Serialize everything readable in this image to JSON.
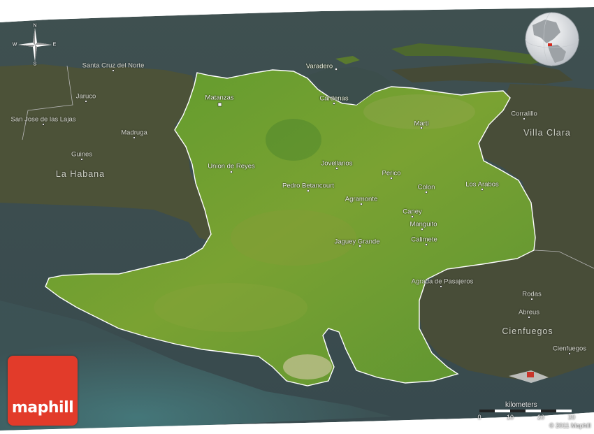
{
  "map": {
    "province": "Matanzas",
    "provincial_cities": [
      {
        "name": "Matanzas",
        "capital": true
      },
      {
        "name": "Cardenas"
      },
      {
        "name": "Varadero"
      },
      {
        "name": "Marti"
      },
      {
        "name": "Union de Reyes"
      },
      {
        "name": "Jovellanos"
      },
      {
        "name": "Perico"
      },
      {
        "name": "Pedro Betancourt"
      },
      {
        "name": "Colon"
      },
      {
        "name": "Los Arabos"
      },
      {
        "name": "Agramonte"
      },
      {
        "name": "Caney"
      },
      {
        "name": "Manguito"
      },
      {
        "name": "Calimete"
      },
      {
        "name": "Jaguey Grande"
      }
    ],
    "neighbouring_places": [
      {
        "name": "Santa Cruz del Norte"
      },
      {
        "name": "Jaruco"
      },
      {
        "name": "San Jose de las Lajas"
      },
      {
        "name": "Madruga"
      },
      {
        "name": "Guines"
      },
      {
        "name": "Corralillo"
      },
      {
        "name": "Agrada de Pasajeros"
      },
      {
        "name": "Rodas"
      },
      {
        "name": "Abreus"
      },
      {
        "name": "Cienfuegos"
      }
    ],
    "regions": [
      {
        "name": "La Habana"
      },
      {
        "name": "Villa Clara"
      },
      {
        "name": "Cienfuegos"
      }
    ],
    "colors": {
      "province_fill": "#6e9a2a",
      "outside_land": "#4b4f3a",
      "sea": "#3d5557",
      "border": "#ffffff"
    }
  },
  "compass": {
    "n": "N",
    "s": "S",
    "e": "E",
    "w": "W"
  },
  "scale": {
    "title": "kilometers",
    "ticks": [
      "0",
      "10",
      "20",
      "30"
    ]
  },
  "brand": {
    "logo_text": "maphill",
    "copyright": "© 2011 Maphill"
  }
}
